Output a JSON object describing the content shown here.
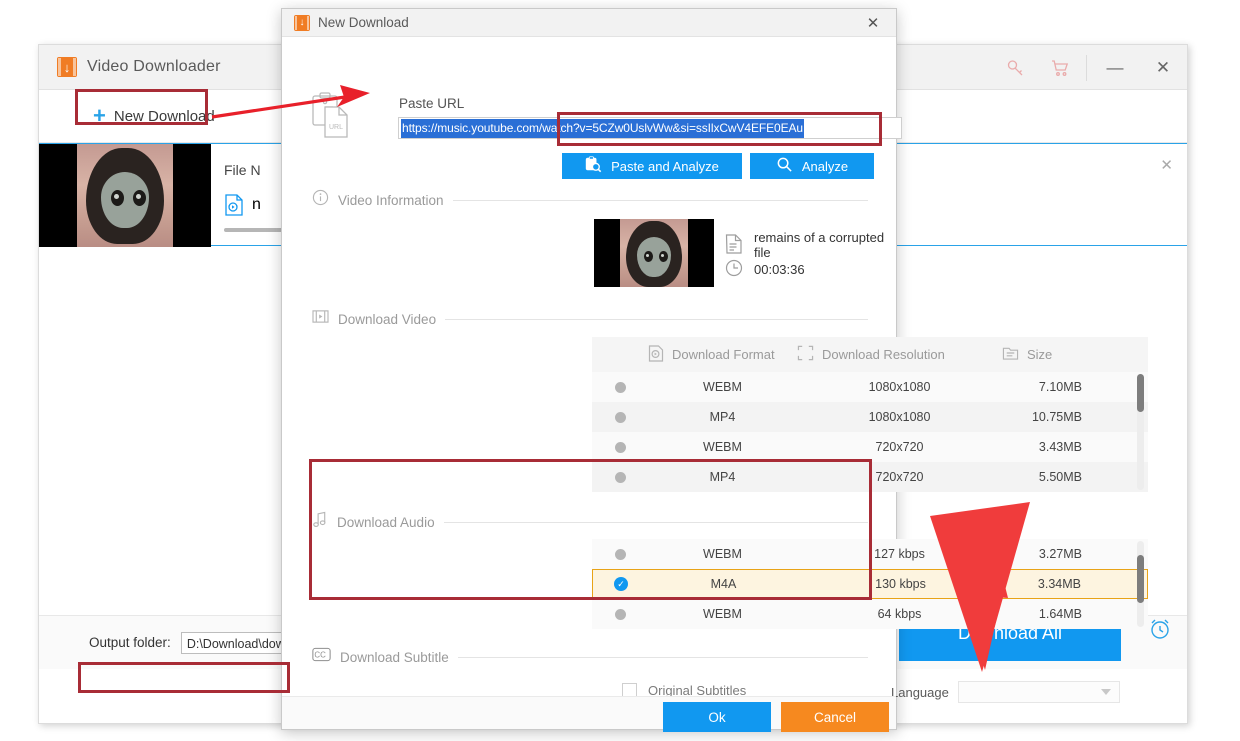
{
  "main_window": {
    "title": "Video Downloader",
    "logo_glyph": "↓",
    "toolbar": {
      "new_download_label": "New Download",
      "plus_glyph": "+"
    },
    "titlebar_icons": {
      "key": "key-icon",
      "cart": "cart-icon",
      "minimize": "—",
      "close": "✕"
    },
    "download_card": {
      "file_name_label": "File N",
      "file_name_value": "n",
      "close_glyph": "✕"
    },
    "footer": {
      "output_folder_label": "Output folder:",
      "output_folder_value": "D:\\Download\\download",
      "download_all_label": "Download All",
      "alarm_icon": "alarm-clock-icon"
    }
  },
  "dialog": {
    "title": "New Download",
    "logo_glyph": "↓",
    "close_glyph": "✕",
    "paste_url": {
      "label": "Paste URL",
      "value": "https://music.youtube.com/watch?v=5CZw0UslvWw&si=ssIlxCwV4EFE0EAu",
      "paste_and_analyze_label": "Paste and Analyze",
      "analyze_label": "Analyze"
    },
    "video_information": {
      "section_label": "Video Information",
      "file_name": "remains of a corrupted file",
      "duration": "00:03:36"
    },
    "download_video": {
      "section_label": "Download Video",
      "columns": [
        "Download Format",
        "Download Resolution",
        "Size"
      ],
      "rows": [
        {
          "selected": false,
          "format": "WEBM",
          "resolution": "1080x1080",
          "size": "7.10MB"
        },
        {
          "selected": false,
          "format": "MP4",
          "resolution": "1080x1080",
          "size": "10.75MB"
        },
        {
          "selected": false,
          "format": "WEBM",
          "resolution": "720x720",
          "size": "3.43MB"
        },
        {
          "selected": false,
          "format": "MP4",
          "resolution": "720x720",
          "size": "5.50MB"
        }
      ]
    },
    "download_audio": {
      "section_label": "Download Audio",
      "rows": [
        {
          "selected": false,
          "format": "WEBM",
          "bitrate": "127 kbps",
          "size": "3.27MB"
        },
        {
          "selected": true,
          "format": "M4A",
          "bitrate": "130 kbps",
          "size": "3.34MB"
        },
        {
          "selected": false,
          "format": "WEBM",
          "bitrate": "64 kbps",
          "size": "1.64MB"
        }
      ]
    },
    "download_subtitle": {
      "section_label": "Download Subtitle",
      "original_subtitles_label": "Original Subtitles",
      "original_subtitles_checked": false,
      "language_label": "Language",
      "language_value": ""
    },
    "footer": {
      "ok_label": "Ok",
      "cancel_label": "Cancel"
    }
  },
  "annotations": {
    "box_color": "#a82c36",
    "arrow_color": "#e8202a",
    "accent_blue": "#1198f0",
    "accent_orange": "#f6891f",
    "selected_row_highlight": "#e8a317"
  }
}
